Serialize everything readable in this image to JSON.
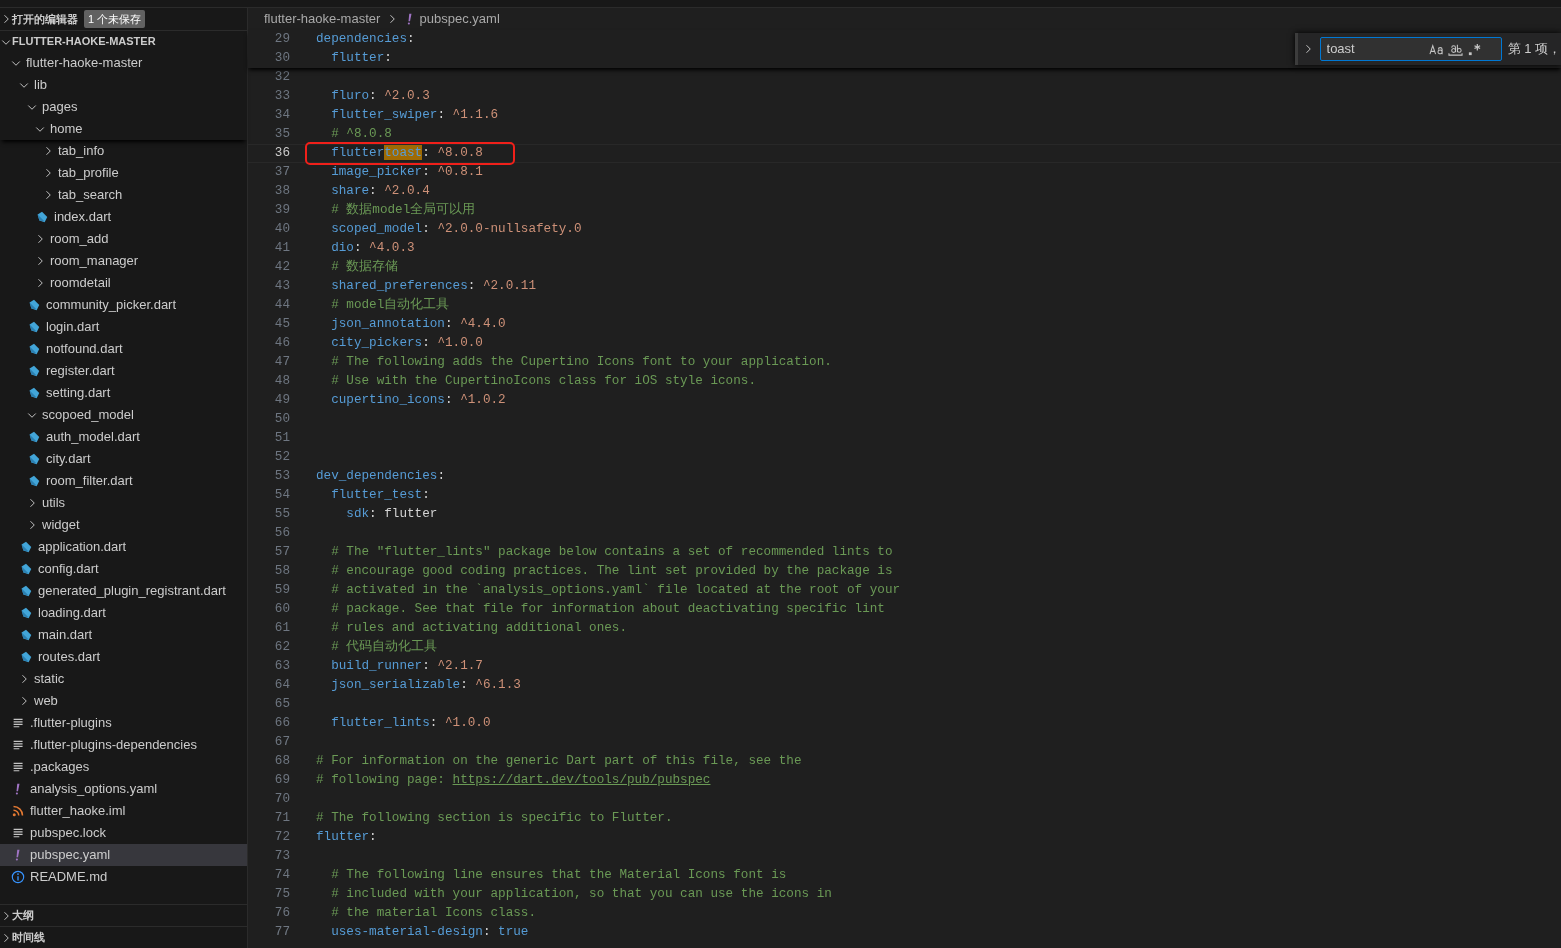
{
  "sidebar": {
    "sections_top": [
      {
        "label": "打开的编辑器",
        "expanded": false,
        "badge": "1 个未保存"
      },
      {
        "label": "FLUTTER-HAOKE-MASTER",
        "expanded": true
      }
    ],
    "tree": [
      {
        "label": "flutter-haoke-master",
        "kind": "folder",
        "expanded": true,
        "selected": false,
        "children": [
          {
            "label": "lib",
            "kind": "folder",
            "expanded": true,
            "selected": false,
            "children": [
              {
                "label": "pages",
                "kind": "folder",
                "expanded": true,
                "selected": false,
                "children": [
                  {
                    "label": "home",
                    "kind": "folder",
                    "expanded": true,
                    "selected": false,
                    "children": [
                      {
                        "label": "tab_info",
                        "kind": "folder",
                        "expanded": false,
                        "selected": false
                      },
                      {
                        "label": "tab_profile",
                        "kind": "folder",
                        "expanded": false,
                        "selected": false
                      },
                      {
                        "label": "tab_search",
                        "kind": "folder",
                        "expanded": false,
                        "selected": false
                      },
                      {
                        "label": "index.dart",
                        "kind": "dart",
                        "selected": false
                      }
                    ]
                  },
                  {
                    "label": "room_add",
                    "kind": "folder",
                    "expanded": false,
                    "selected": false
                  },
                  {
                    "label": "room_manager",
                    "kind": "folder",
                    "expanded": false,
                    "selected": false
                  },
                  {
                    "label": "roomdetail",
                    "kind": "folder",
                    "expanded": false,
                    "selected": false
                  },
                  {
                    "label": "community_picker.dart",
                    "kind": "dart",
                    "selected": false
                  },
                  {
                    "label": "login.dart",
                    "kind": "dart",
                    "selected": false
                  },
                  {
                    "label": "notfound.dart",
                    "kind": "dart",
                    "selected": false
                  },
                  {
                    "label": "register.dart",
                    "kind": "dart",
                    "selected": false
                  },
                  {
                    "label": "setting.dart",
                    "kind": "dart",
                    "selected": false
                  }
                ]
              },
              {
                "label": "scopoed_model",
                "kind": "folder",
                "expanded": true,
                "selected": false,
                "children": [
                  {
                    "label": "auth_model.dart",
                    "kind": "dart",
                    "selected": false
                  },
                  {
                    "label": "city.dart",
                    "kind": "dart",
                    "selected": false
                  },
                  {
                    "label": "room_filter.dart",
                    "kind": "dart",
                    "selected": false
                  }
                ]
              },
              {
                "label": "utils",
                "kind": "folder",
                "expanded": false,
                "selected": false
              },
              {
                "label": "widget",
                "kind": "folder",
                "expanded": false,
                "selected": false
              },
              {
                "label": "application.dart",
                "kind": "dart",
                "selected": false
              },
              {
                "label": "config.dart",
                "kind": "dart",
                "selected": false
              },
              {
                "label": "generated_plugin_registrant.dart",
                "kind": "dart",
                "selected": false
              },
              {
                "label": "loading.dart",
                "kind": "dart",
                "selected": false
              },
              {
                "label": "main.dart",
                "kind": "dart",
                "selected": false
              },
              {
                "label": "routes.dart",
                "kind": "dart",
                "selected": false
              }
            ]
          },
          {
            "label": "static",
            "kind": "folder",
            "expanded": false,
            "selected": false
          },
          {
            "label": "web",
            "kind": "folder",
            "expanded": false,
            "selected": false
          },
          {
            "label": ".flutter-plugins",
            "kind": "text",
            "selected": false
          },
          {
            "label": ".flutter-plugins-dependencies",
            "kind": "text",
            "selected": false
          },
          {
            "label": ".packages",
            "kind": "text",
            "selected": false
          },
          {
            "label": "analysis_options.yaml",
            "kind": "yaml",
            "selected": false
          },
          {
            "label": "flutter_haoke.iml",
            "kind": "feed",
            "selected": false
          },
          {
            "label": "pubspec.lock",
            "kind": "text",
            "selected": false
          },
          {
            "label": "pubspec.yaml",
            "kind": "yaml",
            "selected": true
          },
          {
            "label": "README.md",
            "kind": "info",
            "selected": false
          }
        ]
      }
    ],
    "sections_bottom": [
      {
        "label": "大纲",
        "expanded": false
      },
      {
        "label": "时间线",
        "expanded": false
      }
    ]
  },
  "editor": {
    "breadcrumb": [
      {
        "label": "flutter-haoke-master",
        "kind": "folder"
      },
      {
        "label": "pubspec.yaml",
        "kind": "yaml"
      }
    ],
    "find": {
      "value": "toast",
      "toggles": [
        {
          "kind": "case",
          "on": false
        },
        {
          "kind": "word",
          "on": false
        },
        {
          "kind": "regex",
          "on": false
        }
      ],
      "result": "第 1 项，"
    },
    "sticky_lines": [
      {
        "n": "29",
        "current": false,
        "boxed": false,
        "segs": [
          {
            "kind": "k",
            "text": "dependencies"
          },
          {
            "kind": "p",
            "text": ":"
          }
        ]
      },
      {
        "n": "30",
        "current": false,
        "boxed": false,
        "segs": [
          {
            "kind": "k",
            "text": "  flutter"
          },
          {
            "kind": "p",
            "text": ":"
          }
        ]
      }
    ],
    "lines": [
      {
        "n": "32",
        "current": false,
        "boxed": false
      },
      {
        "n": "33",
        "current": false,
        "boxed": false,
        "segs": [
          {
            "kind": "k",
            "text": "  fluro"
          },
          {
            "kind": "p",
            "text": ": "
          },
          {
            "kind": "v",
            "text": "^2.0.3"
          }
        ]
      },
      {
        "n": "34",
        "current": false,
        "boxed": false,
        "segs": [
          {
            "kind": "k",
            "text": "  flutter_swiper"
          },
          {
            "kind": "p",
            "text": ": "
          },
          {
            "kind": "v",
            "text": "^1.1.6"
          }
        ]
      },
      {
        "n": "35",
        "current": false,
        "boxed": false,
        "segs": [
          {
            "kind": "c",
            "text": "  # ^8.0.8"
          }
        ]
      },
      {
        "n": "36",
        "current": true,
        "boxed": true,
        "segs": [
          {
            "kind": "k",
            "text": "  flutter"
          },
          {
            "kind": "m",
            "text": "toast"
          },
          {
            "kind": "p",
            "text": ": "
          },
          {
            "kind": "v",
            "text": "^8.0.8"
          }
        ]
      },
      {
        "n": "37",
        "current": false,
        "boxed": false,
        "segs": [
          {
            "kind": "k",
            "text": "  image_picker"
          },
          {
            "kind": "p",
            "text": ": "
          },
          {
            "kind": "v",
            "text": "^0.8.1"
          }
        ]
      },
      {
        "n": "38",
        "current": false,
        "boxed": false,
        "segs": [
          {
            "kind": "k",
            "text": "  share"
          },
          {
            "kind": "p",
            "text": ": "
          },
          {
            "kind": "v",
            "text": "^2.0.4"
          }
        ]
      },
      {
        "n": "39",
        "current": false,
        "boxed": false,
        "segs": [
          {
            "kind": "c",
            "text": "  # 数据model全局可以用"
          }
        ]
      },
      {
        "n": "40",
        "current": false,
        "boxed": false,
        "segs": [
          {
            "kind": "k",
            "text": "  scoped_model"
          },
          {
            "kind": "p",
            "text": ": "
          },
          {
            "kind": "v",
            "text": "^2.0.0-nullsafety.0"
          }
        ]
      },
      {
        "n": "41",
        "current": false,
        "boxed": false,
        "segs": [
          {
            "kind": "k",
            "text": "  dio"
          },
          {
            "kind": "p",
            "text": ": "
          },
          {
            "kind": "v",
            "text": "^4.0.3"
          }
        ]
      },
      {
        "n": "42",
        "current": false,
        "boxed": false,
        "segs": [
          {
            "kind": "c",
            "text": "  # 数据存储"
          }
        ]
      },
      {
        "n": "43",
        "current": false,
        "boxed": false,
        "segs": [
          {
            "kind": "k",
            "text": "  shared_preferences"
          },
          {
            "kind": "p",
            "text": ": "
          },
          {
            "kind": "v",
            "text": "^2.0.11"
          }
        ]
      },
      {
        "n": "44",
        "current": false,
        "boxed": false,
        "segs": [
          {
            "kind": "c",
            "text": "  # model自动化工具"
          }
        ]
      },
      {
        "n": "45",
        "current": false,
        "boxed": false,
        "segs": [
          {
            "kind": "k",
            "text": "  json_annotation"
          },
          {
            "kind": "p",
            "text": ": "
          },
          {
            "kind": "v",
            "text": "^4.4.0"
          }
        ]
      },
      {
        "n": "46",
        "current": false,
        "boxed": false,
        "segs": [
          {
            "kind": "k",
            "text": "  city_pickers"
          },
          {
            "kind": "p",
            "text": ": "
          },
          {
            "kind": "v",
            "text": "^1.0.0"
          }
        ]
      },
      {
        "n": "47",
        "current": false,
        "boxed": false,
        "segs": [
          {
            "kind": "c",
            "text": "  # The following adds the Cupertino Icons font to your application."
          }
        ]
      },
      {
        "n": "48",
        "current": false,
        "boxed": false,
        "segs": [
          {
            "kind": "c",
            "text": "  # Use with the CupertinoIcons class for iOS style icons."
          }
        ]
      },
      {
        "n": "49",
        "current": false,
        "boxed": false,
        "segs": [
          {
            "kind": "k",
            "text": "  cupertino_icons"
          },
          {
            "kind": "p",
            "text": ": "
          },
          {
            "kind": "v",
            "text": "^1.0.2"
          }
        ]
      },
      {
        "n": "50",
        "current": false,
        "boxed": false
      },
      {
        "n": "51",
        "current": false,
        "boxed": false
      },
      {
        "n": "52",
        "current": false,
        "boxed": false
      },
      {
        "n": "53",
        "current": false,
        "boxed": false,
        "segs": [
          {
            "kind": "k",
            "text": "dev_dependencies"
          },
          {
            "kind": "p",
            "text": ":"
          }
        ]
      },
      {
        "n": "54",
        "current": false,
        "boxed": false,
        "segs": [
          {
            "kind": "k",
            "text": "  flutter_test"
          },
          {
            "kind": "p",
            "text": ":"
          }
        ]
      },
      {
        "n": "55",
        "current": false,
        "boxed": false,
        "segs": [
          {
            "kind": "k",
            "text": "    sdk"
          },
          {
            "kind": "p",
            "text": ": flutter"
          }
        ]
      },
      {
        "n": "56",
        "current": false,
        "boxed": false
      },
      {
        "n": "57",
        "current": false,
        "boxed": false,
        "segs": [
          {
            "kind": "c",
            "text": "  # The \"flutter_lints\" package below contains a set of recommended lints to"
          }
        ]
      },
      {
        "n": "58",
        "current": false,
        "boxed": false,
        "segs": [
          {
            "kind": "c",
            "text": "  # encourage good coding practices. The lint set provided by the package is"
          }
        ]
      },
      {
        "n": "59",
        "current": false,
        "boxed": false,
        "segs": [
          {
            "kind": "c",
            "text": "  # activated in the `analysis_options.yaml` file located at the root of your"
          }
        ]
      },
      {
        "n": "60",
        "current": false,
        "boxed": false,
        "segs": [
          {
            "kind": "c",
            "text": "  # package. See that file for information about deactivating specific lint"
          }
        ]
      },
      {
        "n": "61",
        "current": false,
        "boxed": false,
        "segs": [
          {
            "kind": "c",
            "text": "  # rules and activating additional ones."
          }
        ]
      },
      {
        "n": "62",
        "current": false,
        "boxed": false,
        "segs": [
          {
            "kind": "c",
            "text": "  # 代码自动化工具"
          }
        ]
      },
      {
        "n": "63",
        "current": false,
        "boxed": false,
        "segs": [
          {
            "kind": "k",
            "text": "  build_runner"
          },
          {
            "kind": "p",
            "text": ": "
          },
          {
            "kind": "v",
            "text": "^2.1.7"
          }
        ]
      },
      {
        "n": "64",
        "current": false,
        "boxed": false,
        "segs": [
          {
            "kind": "k",
            "text": "  json_serializable"
          },
          {
            "kind": "p",
            "text": ": "
          },
          {
            "kind": "v",
            "text": "^6.1.3"
          }
        ]
      },
      {
        "n": "65",
        "current": false,
        "boxed": false
      },
      {
        "n": "66",
        "current": false,
        "boxed": false,
        "segs": [
          {
            "kind": "k",
            "text": "  flutter_lints"
          },
          {
            "kind": "p",
            "text": ": "
          },
          {
            "kind": "v",
            "text": "^1.0.0"
          }
        ]
      },
      {
        "n": "67",
        "current": false,
        "boxed": false
      },
      {
        "n": "68",
        "current": false,
        "boxed": false,
        "segs": [
          {
            "kind": "c",
            "text": "# For information on the generic Dart part of this file, see the"
          }
        ]
      },
      {
        "n": "69",
        "current": false,
        "boxed": false,
        "segs": [
          {
            "kind": "c",
            "text": "# following page: "
          },
          {
            "kind": "u",
            "text": "https://dart.dev/tools/pub/pubspec"
          }
        ]
      },
      {
        "n": "70",
        "current": false,
        "boxed": false
      },
      {
        "n": "71",
        "current": false,
        "boxed": false,
        "segs": [
          {
            "kind": "c",
            "text": "# The following section is specific to Flutter."
          }
        ]
      },
      {
        "n": "72",
        "current": false,
        "boxed": false,
        "segs": [
          {
            "kind": "k",
            "text": "flutter"
          },
          {
            "kind": "p",
            "text": ":"
          }
        ]
      },
      {
        "n": "73",
        "current": false,
        "boxed": false
      },
      {
        "n": "74",
        "current": false,
        "boxed": false,
        "segs": [
          {
            "kind": "c",
            "text": "  # The following line ensures that the Material Icons font is"
          }
        ]
      },
      {
        "n": "75",
        "current": false,
        "boxed": false,
        "segs": [
          {
            "kind": "c",
            "text": "  # included with your application, so that you can use the icons in"
          }
        ]
      },
      {
        "n": "76",
        "current": false,
        "boxed": false,
        "segs": [
          {
            "kind": "c",
            "text": "  # the material Icons class."
          }
        ]
      },
      {
        "n": "77",
        "current": false,
        "boxed": false,
        "segs": [
          {
            "kind": "k",
            "text": "  uses-material-design"
          },
          {
            "kind": "p",
            "text": ": "
          },
          {
            "kind": "b",
            "text": "true"
          }
        ]
      }
    ]
  }
}
